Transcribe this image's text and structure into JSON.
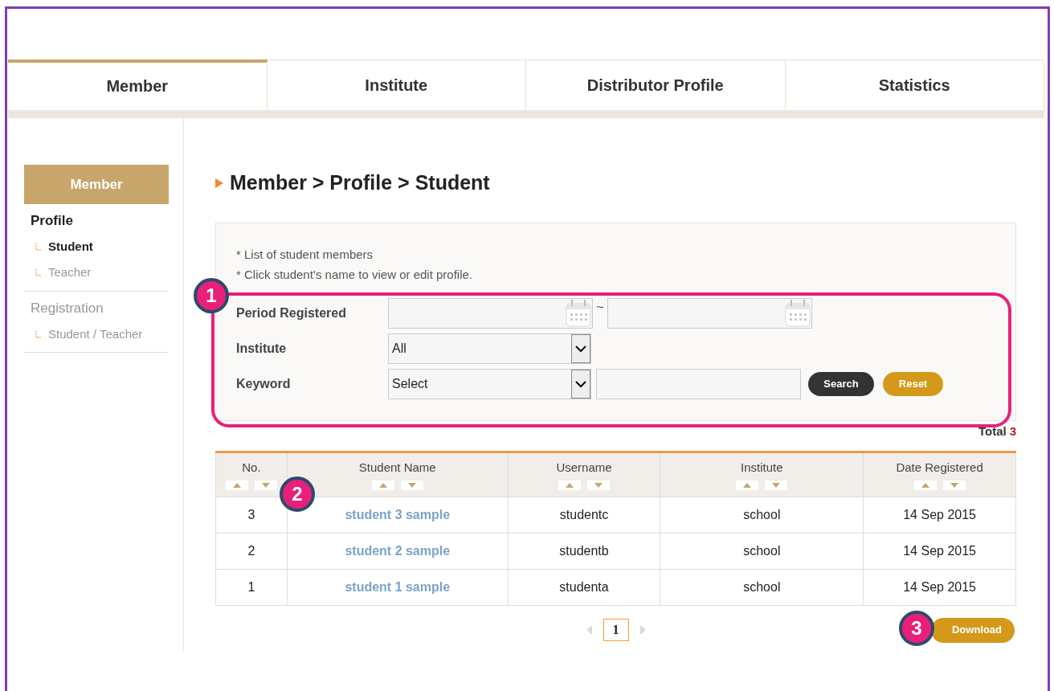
{
  "tabs": [
    {
      "label": "Member",
      "selected": true
    },
    {
      "label": "Institute",
      "selected": false
    },
    {
      "label": "Distributor Profile",
      "selected": false
    },
    {
      "label": "Statistics",
      "selected": false
    }
  ],
  "sidebar": {
    "title": "Member",
    "sections": [
      {
        "label": "Profile",
        "selected": true,
        "children": [
          {
            "label": "Student",
            "selected": true
          },
          {
            "label": "Teacher",
            "selected": false
          }
        ]
      },
      {
        "label": "Registration",
        "selected": false,
        "children": [
          {
            "label": "Student / Teacher",
            "selected": false
          }
        ]
      }
    ]
  },
  "breadcrumb": "Member > Profile > Student",
  "notes": [
    "* List of student members",
    "* Click student’s name to view or edit profile."
  ],
  "filters": {
    "period_label": "Period Registered",
    "range_separator": "~",
    "institute_label": "Institute",
    "institute_value": "All",
    "keyword_label": "Keyword",
    "keyword_field_value": "Select",
    "search": "Search",
    "reset": "Reset"
  },
  "total": {
    "label": "Total",
    "value": "3"
  },
  "table": {
    "columns": [
      "No.",
      "Student Name",
      "Username",
      "Institute",
      "Date Registered"
    ],
    "rows": [
      [
        "3",
        "student 3 sample",
        "studentc",
        "school",
        "14 Sep 2015"
      ],
      [
        "2",
        "student 2 sample",
        "studentb",
        "school",
        "14 Sep 2015"
      ],
      [
        "1",
        "student 1 sample",
        "studenta",
        "school",
        "14 Sep 2015"
      ]
    ]
  },
  "pagination": {
    "pages": [
      {
        "label": "1",
        "selected": true
      }
    ]
  },
  "download": "Download",
  "callouts": [
    "1",
    "2",
    "3"
  ]
}
